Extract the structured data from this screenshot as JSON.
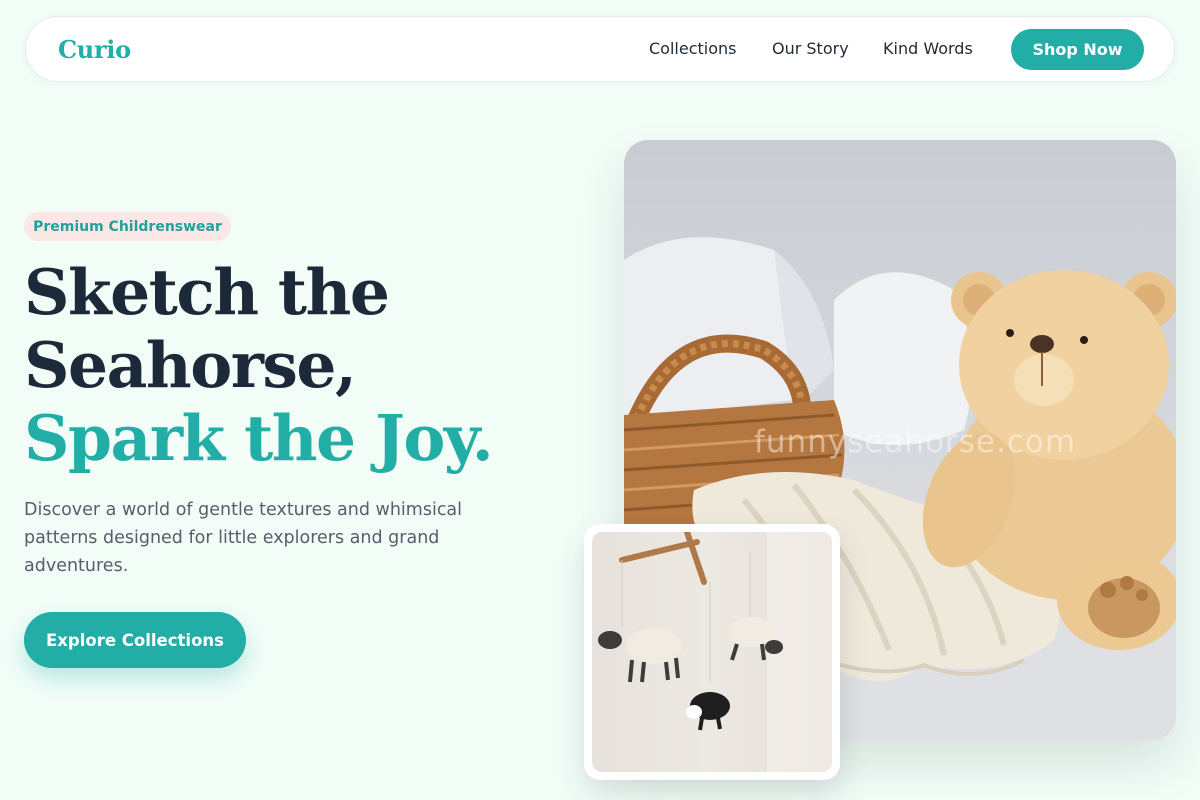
{
  "nav": {
    "logo": "Curio",
    "links": [
      "Collections",
      "Our Story",
      "Kind Words"
    ],
    "cta": "Shop Now"
  },
  "hero": {
    "badge": "Premium Childrenswear",
    "headline_line1": "Sketch the",
    "headline_line2": "Seahorse,",
    "headline_line3": "Spark the Joy.",
    "description": "Discover a world of gentle textures and whimsical patterns designed for little explorers and grand adventures.",
    "cta": "Explore Collections"
  },
  "images": {
    "main_watermark": "funnyseahorse.com"
  },
  "colors": {
    "accent": "#22ada6",
    "heading": "#1c2939",
    "background": "#f2fdf8",
    "badge_bg": "#fce7e7"
  }
}
